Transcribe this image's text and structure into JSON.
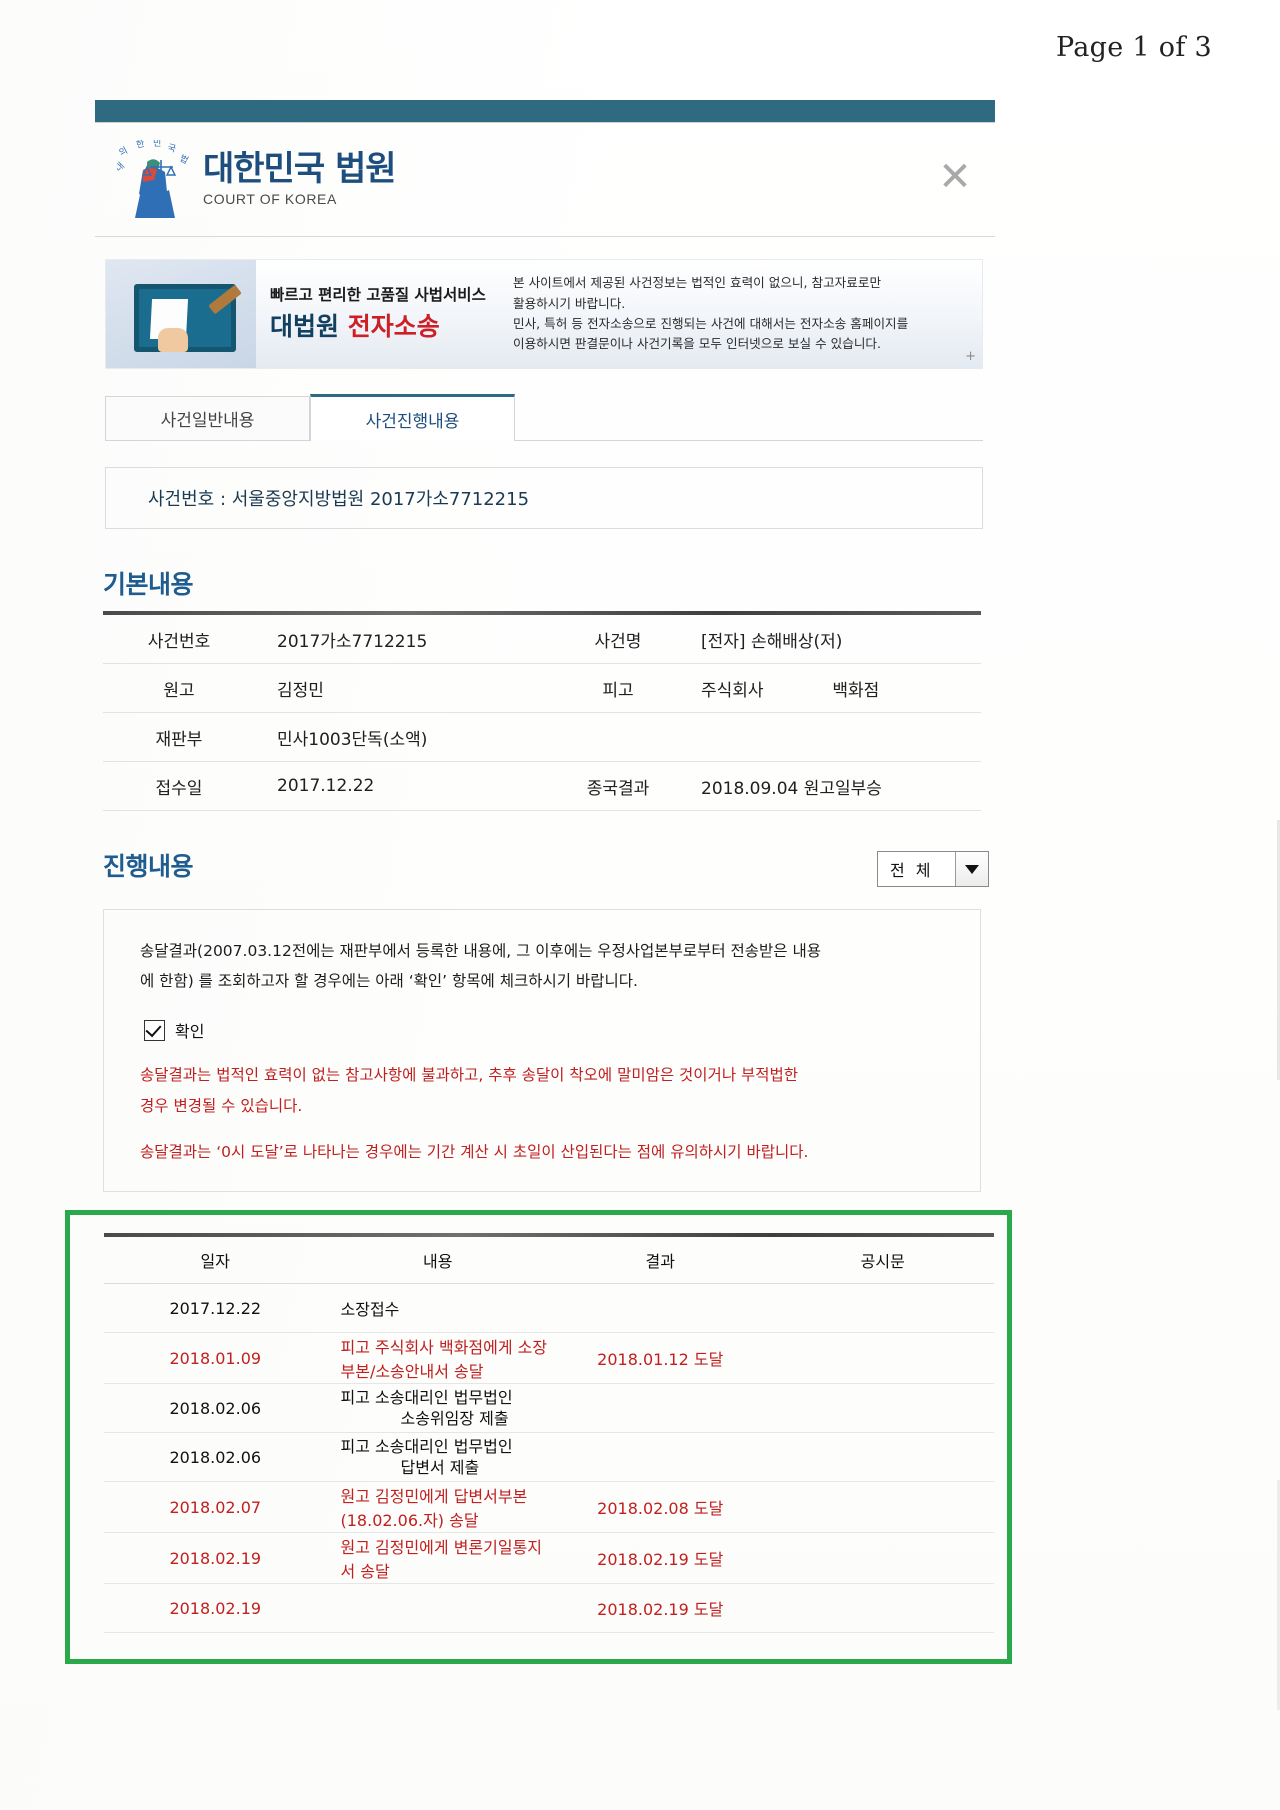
{
  "page": {
    "page_label": "Page 1 of 3"
  },
  "header": {
    "logo_kr": "대한민국 법원",
    "logo_en": "COURT OF KOREA",
    "close_icon": "close-icon"
  },
  "banner": {
    "slogan_line1": "빠르고 편리한 고품질 사법서비스",
    "slogan_line2_black": "대법원",
    "slogan_line2_red": "전자소송",
    "note_line1": "본 사이트에서 제공된 사건정보는 법적인 효력이 없으니, 참고자료로만",
    "note_line2": "활용하시기 바랍니다.",
    "note_line3": "민사, 특허 등 전자소송으로 진행되는 사건에 대해서는 전자소송 홈페이지를",
    "note_line4": "이용하시면 판결문이나 사건기록을 모두 인터넷으로 보실 수 있습니다.",
    "plus_icon": "+"
  },
  "tabs": [
    {
      "label": "사건일반내용",
      "active": false
    },
    {
      "label": "사건진행내용",
      "active": true
    }
  ],
  "case_number_bar": "사건번호 : 서울중앙지방법원 2017가소7712215",
  "basic_section": {
    "title": "기본내용",
    "rows": [
      {
        "label1": "사건번호",
        "value1": "2017가소7712215",
        "label2": "사건명",
        "value2": "[전자] 손해배상(저)"
      },
      {
        "label1": "원고",
        "value1": "김정민",
        "label2": "피고",
        "value2a": "주식회사",
        "value2b": "백화점"
      },
      {
        "label1": "재판부",
        "value1": "민사1003단독(소액)",
        "label2": "",
        "value2": ""
      },
      {
        "label1": "접수일",
        "value1": "2017.12.22",
        "label2": "종국결과",
        "value2": "2018.09.04 원고일부승"
      }
    ]
  },
  "progress_section": {
    "title": "진행내용",
    "filter_value": "전 체",
    "notice_line1": "송달결과(2007.03.12전에는 재판부에서 등록한 내용에, 그 이후에는 우정사업본부로부터 전송받은 내용",
    "notice_line2": "에 한함) 를 조회하고자 할 경우에는 아래 ‘확인’ 항목에 체크하시기 바랍니다.",
    "checkbox_label": "확인",
    "checkbox_checked": true,
    "red_line1": "송달결과는 법적인 효력이 없는 참고사항에 불과하고, 추후 송달이 착오에 말미암은 것이거나 부적법한",
    "red_line2": "경우 변경될 수 있습니다.",
    "red_line3": "송달결과는 ‘0시 도달’로 나타나는 경우에는 기간 계산 시 초일이 산입된다는 점에 유의하시기 바랍니다.",
    "table": {
      "headers": [
        "일자",
        "내용",
        "결과",
        "공시문"
      ],
      "rows": [
        {
          "date": "2017.12.22",
          "content": "소장접수",
          "content2": "",
          "result": "",
          "public": "",
          "red": false
        },
        {
          "date": "2018.01.09",
          "content": "피고 주식회사        백화점에게 소장부본/소송안내서 송달",
          "content2": "",
          "result": "2018.01.12 도달",
          "public": "",
          "red": true
        },
        {
          "date": "2018.02.06",
          "content": "피고 소송대리인 법무법인",
          "content2": "소송위임장 제출",
          "result": "",
          "public": "",
          "red": false
        },
        {
          "date": "2018.02.06",
          "content": "피고 소송대리인 법무법인",
          "content2": "답변서 제출",
          "result": "",
          "public": "",
          "red": false
        },
        {
          "date": "2018.02.07",
          "content": "원고 김정민에게 답변서부본(18.02.06.자) 송달",
          "content2": "",
          "result": "2018.02.08 도달",
          "public": "",
          "red": true
        },
        {
          "date": "2018.02.19",
          "content": "원고 김정민에게 변론기일통지서 송달",
          "content2": "",
          "result": "2018.02.19 도달",
          "public": "",
          "red": true
        },
        {
          "date": "2018.02.19",
          "content": "",
          "content2": "",
          "result": "2018.02.19 도달",
          "public": "",
          "red": true
        }
      ]
    }
  },
  "colors": {
    "accent_teal": "#2e6b80",
    "heading_blue": "#1f5c90",
    "red_text": "#c0201f",
    "highlight_green": "#2aa84a"
  }
}
